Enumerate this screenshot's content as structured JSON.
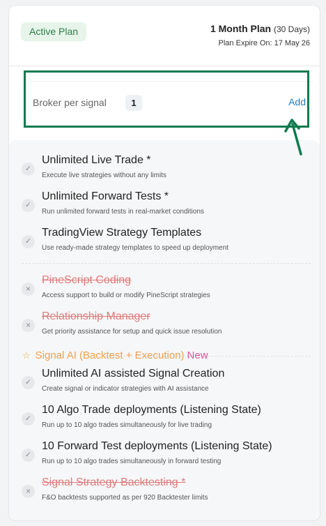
{
  "header": {
    "badge": "Active Plan",
    "plan_name": "1 Month Plan",
    "plan_duration": "(30 Days)",
    "expire_text": "Plan Expire On: 17 May 26"
  },
  "broker": {
    "label": "Broker per signal",
    "count": "1",
    "add_label": "Add"
  },
  "features": [
    {
      "title": "Unlimited Live Trade *",
      "desc": "Execute live strategies without any limits",
      "status": "included"
    },
    {
      "title": "Unlimited Forward Tests *",
      "desc": "Run unlimited forward tests in real-market conditions",
      "status": "included"
    },
    {
      "title": "TradingView Strategy Templates",
      "desc": "Use ready-made strategy templates to speed up deployment",
      "status": "included"
    },
    {
      "title": "PineScript Coding",
      "desc": "Access support to build or modify PineScript strategies",
      "status": "excluded"
    },
    {
      "title": "Relationship Manager",
      "desc": "Get priority assistance for setup and quick issue resolution",
      "status": "excluded"
    }
  ],
  "signal_section": {
    "title": "Signal AI (Backtest + Execution)",
    "tag": "New"
  },
  "signal_features": [
    {
      "title": "Unlimited AI assisted Signal Creation",
      "desc": "Create signal or indicator strategies with AI assistance",
      "status": "included"
    },
    {
      "title": "10 Algo Trade deployments (Listening State)",
      "desc": "Run up to 10 algo trades simultaneously for live trading",
      "status": "included"
    },
    {
      "title": "10 Forward Test deployments (Listening State)",
      "desc": "Run up to 10 algo trades simultaneously in forward testing",
      "status": "included"
    },
    {
      "title": "Signal Strategy Backtesting *",
      "desc": "F&O backtests supported as per 920 Backtester limits",
      "status": "excluded"
    }
  ],
  "icons": {
    "included": "check-icon",
    "excluded": "x-icon",
    "section": "star-icon"
  },
  "colors": {
    "highlight": "#0f7a4f",
    "badge_bg": "#e6f4ea",
    "badge_text": "#2e7d48",
    "link": "#1e7fc4",
    "excluded_text": "#e07a7a",
    "section_title": "#f0a04b",
    "new_tag": "#e0559a"
  }
}
